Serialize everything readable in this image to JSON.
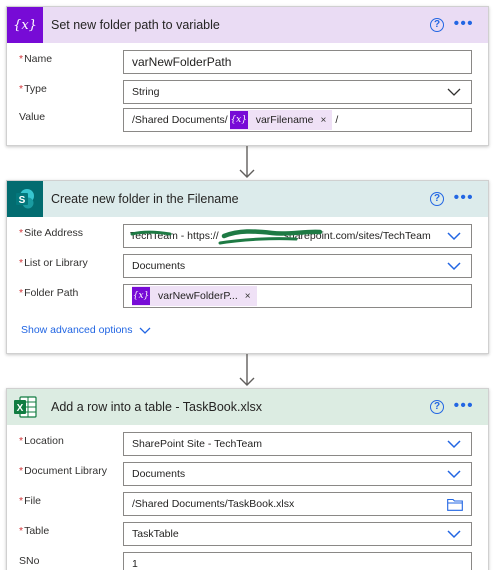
{
  "card1": {
    "title": "Set new folder path to variable",
    "help": "?",
    "more": "•••",
    "name_label": "Name",
    "name_value": "varNewFolderPath",
    "type_label": "Type",
    "type_value": "String",
    "value_label": "Value",
    "value_prefix": "/Shared Documents/",
    "value_token": "varFilename",
    "value_suffix": "/",
    "token_icon": "{x}"
  },
  "card2": {
    "title": "Create new folder in the Filename",
    "help": "?",
    "more": "•••",
    "site_label": "Site Address",
    "site_value_start": "TechTeam - https://",
    "site_value_end": ".sharepoint.com/sites/TechTeam",
    "list_label": "List or Library",
    "list_value": "Documents",
    "folder_label": "Folder Path",
    "folder_token": "varNewFolderP...",
    "token_icon": "{x}",
    "advanced_label": "Show advanced options"
  },
  "card3": {
    "title": "Add a row into a table - TaskBook.xlsx",
    "help": "?",
    "more": "•••",
    "location_label": "Location",
    "location_value": "SharePoint Site - TechTeam",
    "doclib_label": "Document Library",
    "doclib_value": "Documents",
    "file_label": "File",
    "file_value": "/Shared Documents/TaskBook.xlsx",
    "table_label": "Table",
    "table_value": "TaskTable",
    "sno_label": "SNo",
    "sno_value": "1"
  },
  "required_marker": "*",
  "token_remove": "×",
  "colors": {
    "variable_header": "#eadcf4",
    "sharepoint_header": "#dcebeb",
    "excel_header": "#dcece2",
    "variable_icon": "#770bd6",
    "sharepoint_icon": "#036c70",
    "excel_icon": "#107c41",
    "accent": "#2266e3",
    "required": "#d13438"
  },
  "icons": {
    "card1": "variable-icon",
    "card2": "sharepoint-icon",
    "card3": "excel-icon"
  }
}
